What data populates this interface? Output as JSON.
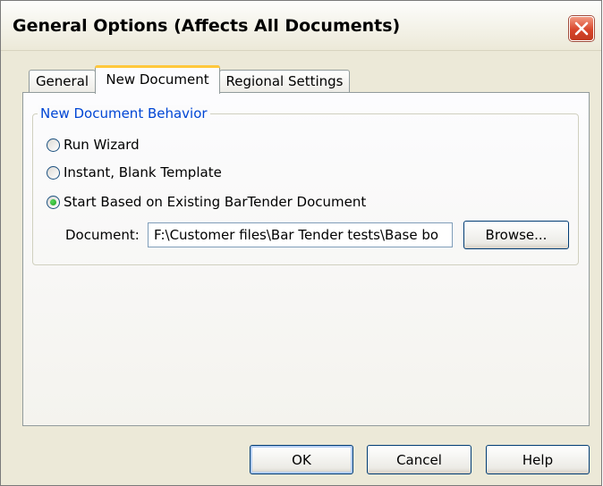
{
  "window": {
    "title": "General Options (Affects All Documents)"
  },
  "tabs": [
    {
      "label": "General",
      "selected": false
    },
    {
      "label": "New Document",
      "selected": true
    },
    {
      "label": "Regional Settings",
      "selected": false
    }
  ],
  "group": {
    "title": "New Document Behavior",
    "options": [
      {
        "label": "Run Wizard",
        "checked": false
      },
      {
        "label": "Instant, Blank Template",
        "checked": false
      },
      {
        "label": "Start Based on Existing BarTender Document",
        "checked": true
      }
    ],
    "document_label": "Document:",
    "document_value": "F:\\Customer files\\Bar Tender tests\\Base bo",
    "browse_label": "Browse..."
  },
  "buttons": {
    "ok": "OK",
    "cancel": "Cancel",
    "help": "Help"
  },
  "colors": {
    "group_title": "#0046d5",
    "tab_highlight": "#ffc83c",
    "close_button": "#d8452a"
  }
}
